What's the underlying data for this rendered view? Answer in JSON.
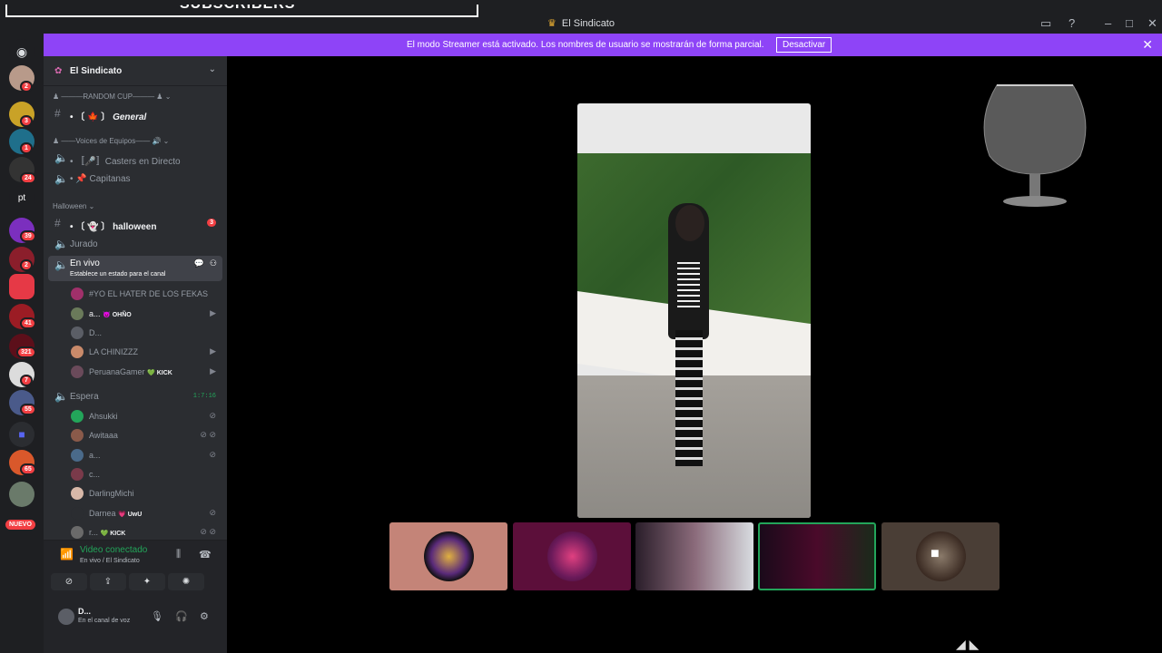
{
  "overlay": {
    "text": "SUBSCRIBERS"
  },
  "window": {
    "title": "El Sindicato"
  },
  "banner": {
    "message": "El modo Streamer está activado. Los nombres de usuario se mostrarán de forma parcial.",
    "action": "Desactivar"
  },
  "servers": {
    "badges": [
      "2",
      "3",
      "1",
      "24",
      "39",
      "2",
      "41",
      "321",
      "7",
      "55",
      "65"
    ],
    "nuevo": "NUEVO",
    "pt": "pt"
  },
  "guild": {
    "name": "El Sindicato"
  },
  "categories": {
    "random_cup": "———RANDOM CUP———",
    "voices": "——Voices de Equipos——",
    "halloween": "Halloween"
  },
  "channels": {
    "general": "General",
    "general_prefix": "• 〔 🍁 〕",
    "casters": "• 〚🎤〛Casters en Directo",
    "capitanas": "• 📌 Capitanas",
    "halloween": "halloween",
    "halloween_prefix": "• 〔 👻 〕",
    "halloween_badge": "3",
    "jurado": "Jurado",
    "envivo": "En vivo",
    "envivo_status": "Establece un estado para el canal",
    "espera": "Espera",
    "espera_timer": "1:7:16"
  },
  "envivo_members": [
    {
      "name": "#YO EL HATER DE LOS FEKAS",
      "tag": ""
    },
    {
      "name": "a...",
      "tag": "😈 OHÑO"
    },
    {
      "name": "D...",
      "tag": ""
    },
    {
      "name": "LA CHINIZZZ",
      "tag": ""
    },
    {
      "name": "PeruanaGamer",
      "tag": "💚 KICK"
    }
  ],
  "espera_members": [
    {
      "name": "Ahsukki",
      "tag": ""
    },
    {
      "name": "Awitaaa",
      "tag": ""
    },
    {
      "name": "a...",
      "tag": ""
    },
    {
      "name": "c...",
      "tag": ""
    },
    {
      "name": "DarlingMichi",
      "tag": ""
    },
    {
      "name": "Darnea",
      "tag": "💗 UwU"
    },
    {
      "name": "r...",
      "tag": "💚 KICK"
    }
  ],
  "voice": {
    "status": "Video conectado",
    "location": "En vivo / El Sindicato"
  },
  "user": {
    "name": "D...",
    "status": "En el canal de voz"
  },
  "colors": {
    "accent": "#8e44f7",
    "online": "#23a55a",
    "badge": "#f23f43"
  }
}
